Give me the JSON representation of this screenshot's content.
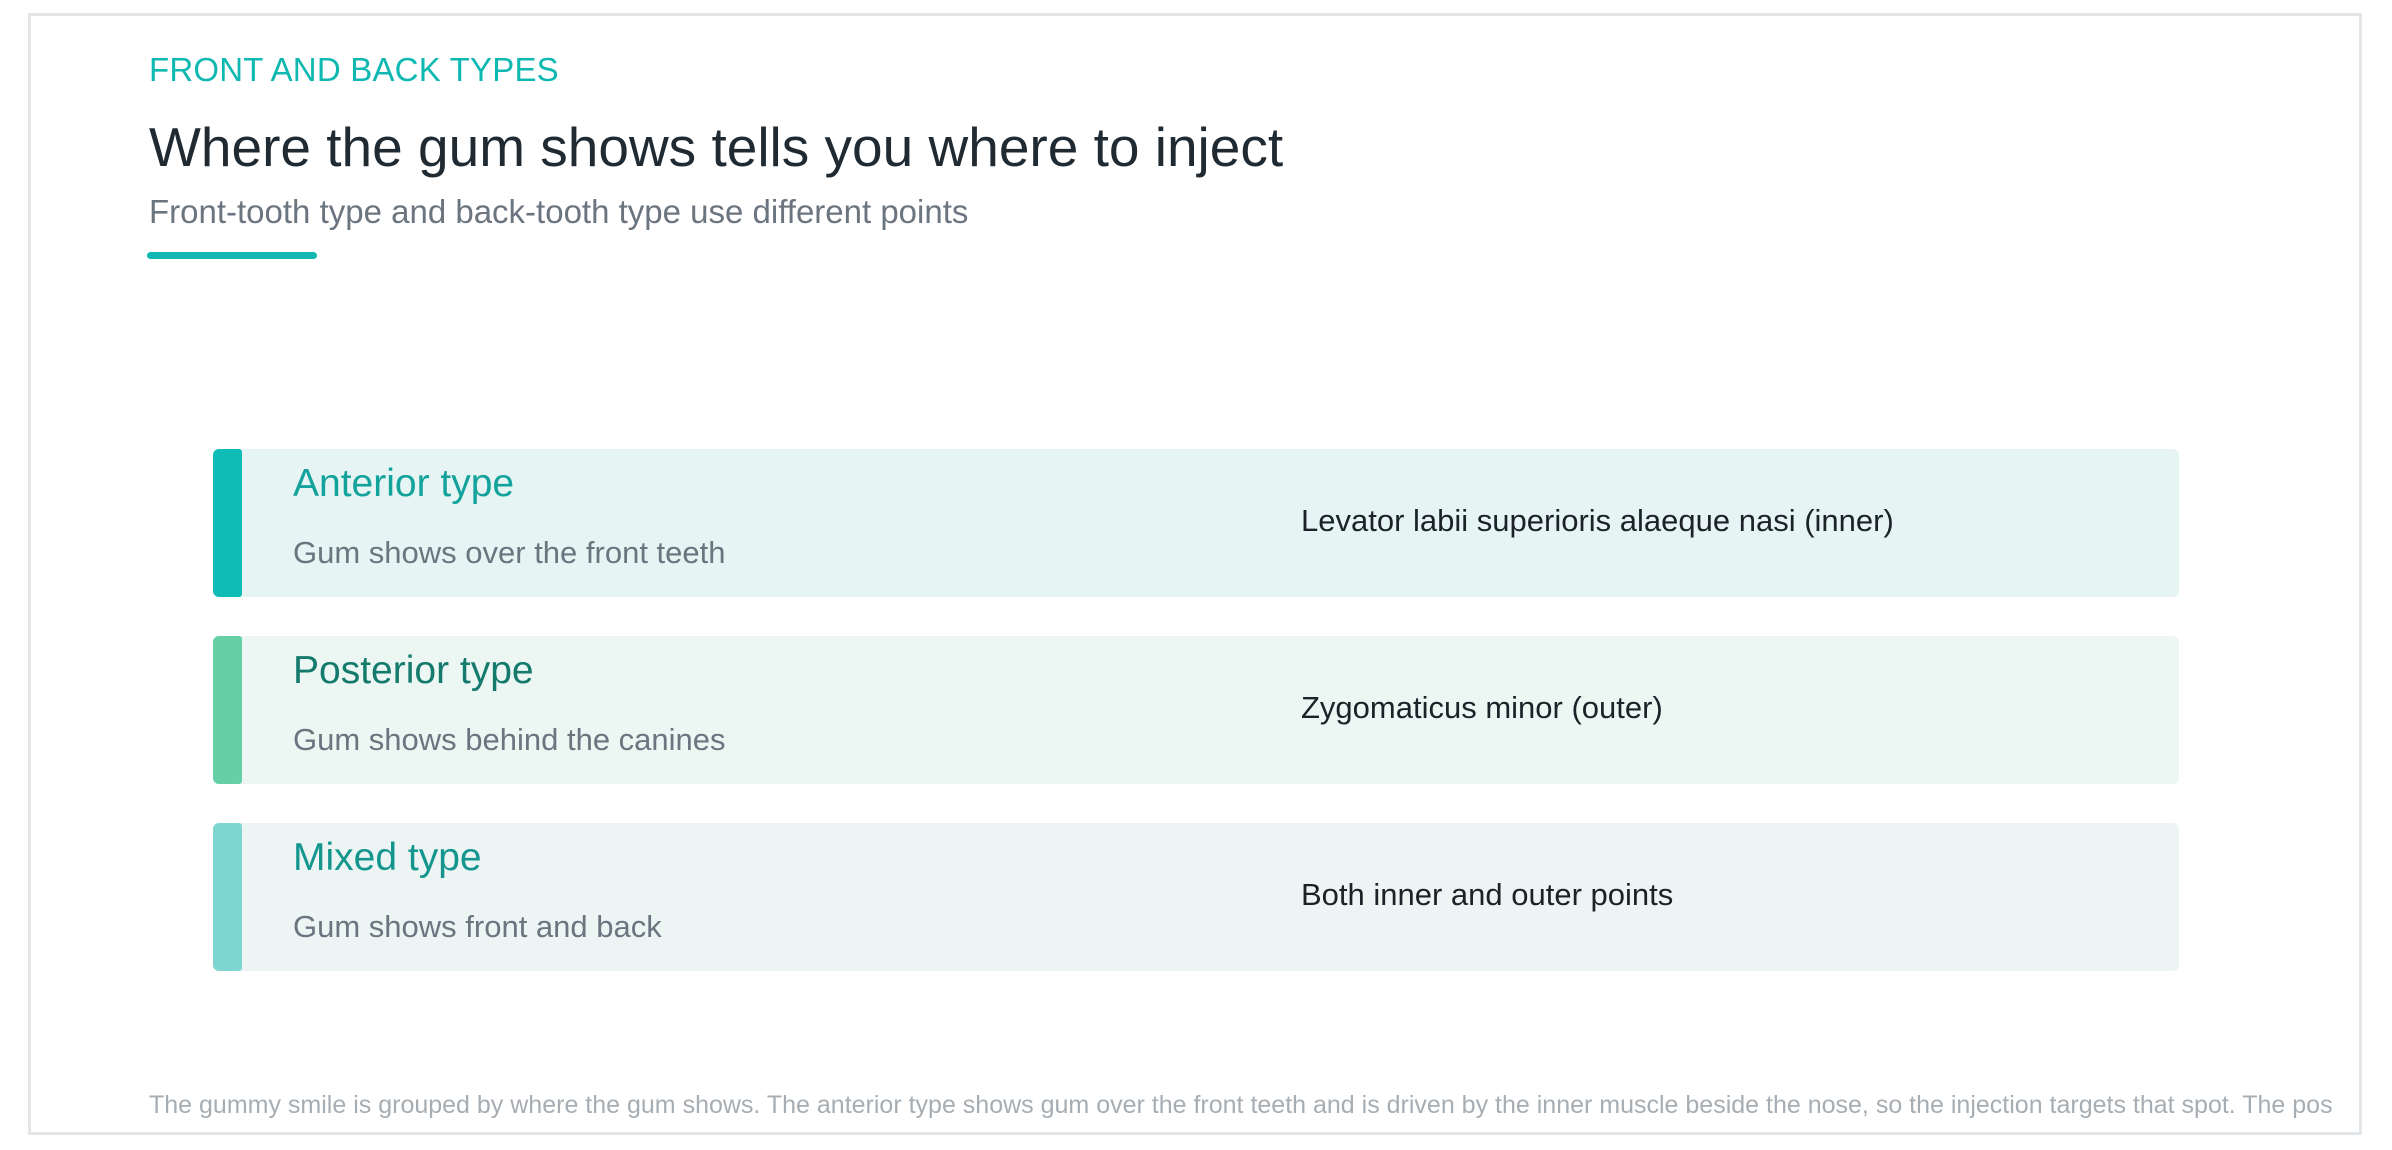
{
  "header": {
    "eyebrow": "FRONT AND BACK TYPES",
    "title": "Where the gum shows tells you where to inject",
    "subtitle": "Front-tooth type and back-tooth type use different points"
  },
  "types": [
    {
      "name": "Anterior type",
      "description": "Gum shows over the front teeth",
      "muscle": "Levator labii superioris alaeque nasi (inner)",
      "stripe_color": "#0fbdb6",
      "background_color": "#e6f4f3",
      "name_color": "#14a29c"
    },
    {
      "name": "Posterior type",
      "description": "Gum shows behind the canines",
      "muscle": "Zygomaticus minor (outer)",
      "stripe_color": "#66cfa6",
      "background_color": "#ecf6f3",
      "name_color": "#137a6c"
    },
    {
      "name": "Mixed type",
      "description": "Gum shows front and back",
      "muscle": "Both inner and outer points",
      "stripe_color": "#7fd6d0",
      "background_color": "#ecf5f4",
      "name_color": "#14968f"
    }
  ],
  "footnote": "The gummy smile is grouped by where the gum shows. The anterior type shows gum over the front teeth and is driven by the inner muscle beside the nose, so the injection targets that spot. The pos"
}
